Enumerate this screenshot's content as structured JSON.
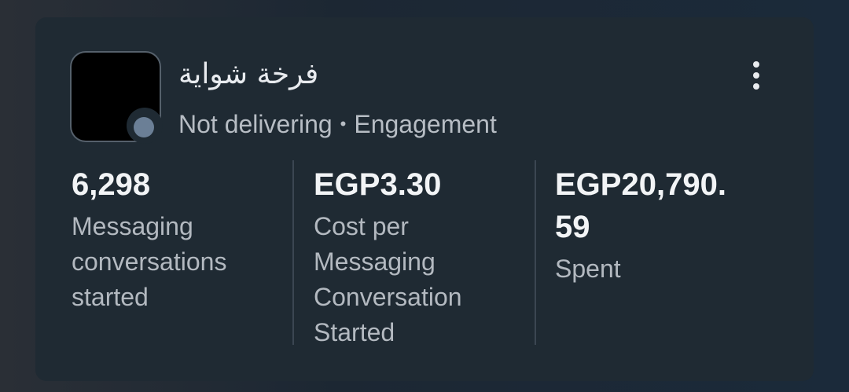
{
  "campaign": {
    "name": "فرخة شواية",
    "status": "Not delivering",
    "separator": "•",
    "objective": "Engagement"
  },
  "metrics": [
    {
      "value": "6,298",
      "label_lines": [
        "Messaging",
        "conversations",
        "started"
      ]
    },
    {
      "value": "EGP3.30",
      "label_lines": [
        "Cost per",
        "Messaging",
        "Conversation",
        "Started"
      ]
    },
    {
      "value_lines": [
        "EGP20,790.",
        "59"
      ],
      "label_lines": [
        "Spent"
      ]
    }
  ],
  "colors": {
    "card_bg": "#1f2a33",
    "status_dot": "#6b7f96",
    "text_primary": "#f2f4f6",
    "text_secondary": "#b3b9c0"
  }
}
